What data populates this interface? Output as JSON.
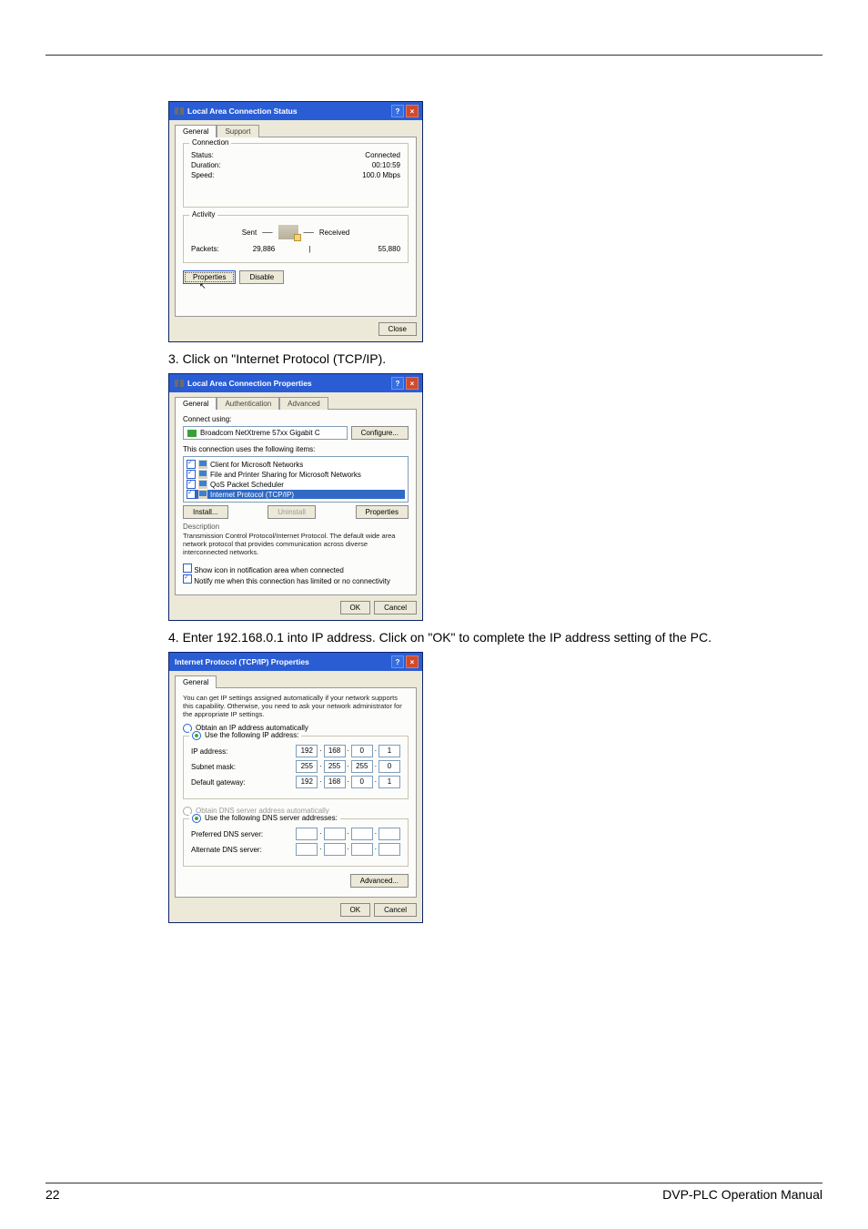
{
  "top_rule_present": true,
  "dialog_status": {
    "title_icon": "plug-icon",
    "title": "Local Area Connection Status",
    "help": "?",
    "close": "×",
    "tabs": {
      "general": "General",
      "support": "Support"
    },
    "conn_group_title": "Connection",
    "status_label": "Status:",
    "status_value": "Connected",
    "duration_label": "Duration:",
    "duration_value": "00:10:59",
    "speed_label": "Speed:",
    "speed_value": "100.0 Mbps",
    "activity_group_title": "Activity",
    "sent_label": "Sent",
    "recv_label": "Received",
    "packets_label": "Packets:",
    "packets_sent": "29,886",
    "packets_sep": "|",
    "packets_recv": "55,880",
    "btn_properties": "Properties",
    "btn_disable": "Disable",
    "btn_close": "Close"
  },
  "step3": "3.  Click on \"Internet Protocol (TCP/IP).",
  "dialog_props": {
    "title_icon": "plug-icon",
    "title": "Local Area Connection Properties",
    "help": "?",
    "close": "×",
    "tabs": {
      "general": "General",
      "auth": "Authentication",
      "adv": "Advanced"
    },
    "connect_using_label": "Connect using:",
    "adapter": "Broadcom NetXtreme 57xx Gigabit C",
    "btn_configure": "Configure...",
    "items_label": "This connection uses the following items:",
    "items": [
      {
        "label": "Client for Microsoft Networks",
        "checked": true,
        "selected": false
      },
      {
        "label": "File and Printer Sharing for Microsoft Networks",
        "checked": true,
        "selected": false
      },
      {
        "label": "QoS Packet Scheduler",
        "checked": true,
        "selected": false
      },
      {
        "label": "Internet Protocol (TCP/IP)",
        "checked": true,
        "selected": true
      }
    ],
    "btn_install": "Install...",
    "btn_uninstall": "Uninstall",
    "btn_props": "Properties",
    "desc_header": "Description",
    "desc_text": "Transmission Control Protocol/Internet Protocol. The default wide area network protocol that provides communication across diverse interconnected networks.",
    "chk1_label": "Show icon in notification area when connected",
    "chk1_checked": false,
    "chk2_label": "Notify me when this connection has limited or no connectivity",
    "chk2_checked": true,
    "btn_ok": "OK",
    "btn_cancel": "Cancel"
  },
  "step4": "4.  Enter 192.168.0.1 into IP address. Click on \"OK\" to complete the IP address setting of the PC.",
  "dialog_tcpip": {
    "title": "Internet Protocol (TCP/IP) Properties",
    "help": "?",
    "close": "×",
    "tab_general": "General",
    "intro": "You can get IP settings assigned automatically if your network supports this capability. Otherwise, you need to ask your network administrator for the appropriate IP settings.",
    "r_auto": "Obtain an IP address automatically",
    "r_manual": "Use the following IP address:",
    "ip_label": "IP address:",
    "ip": [
      "192",
      "168",
      "0",
      "1"
    ],
    "mask_label": "Subnet mask:",
    "mask": [
      "255",
      "255",
      "255",
      "0"
    ],
    "gw_label": "Default gateway:",
    "gw": [
      "192",
      "168",
      "0",
      "1"
    ],
    "r_dns_auto": "Obtain DNS server address automatically",
    "r_dns_manual": "Use the following DNS server addresses:",
    "pdns_label": "Preferred DNS server:",
    "adns_label": "Alternate DNS server:",
    "btn_adv": "Advanced...",
    "btn_ok": "OK",
    "btn_cancel": "Cancel"
  },
  "footer": {
    "page": "22",
    "manual": "DVP-PLC  Operation  Manual"
  }
}
